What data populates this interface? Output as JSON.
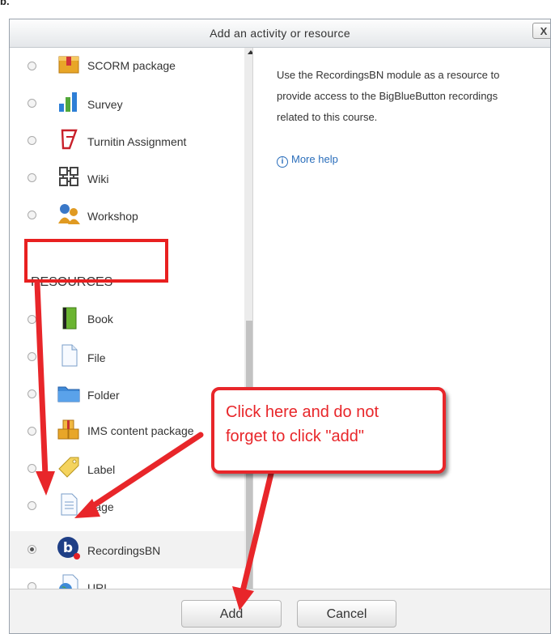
{
  "corner_text": "b.",
  "dialog": {
    "title": "Add an activity or resource",
    "close_label": "X"
  },
  "activities": [
    {
      "label": "SCORM package",
      "icon": "scorm-package-icon"
    },
    {
      "label": "Survey",
      "icon": "survey-chart-icon"
    },
    {
      "label": "Turnitin Assignment",
      "icon": "turnitin-icon"
    },
    {
      "label": "Wiki",
      "icon": "wiki-icon"
    },
    {
      "label": "Workshop",
      "icon": "workshop-people-icon"
    }
  ],
  "resources_heading": "RESOURCES",
  "resources": [
    {
      "label": "Book",
      "icon": "book-icon"
    },
    {
      "label": "File",
      "icon": "file-icon"
    },
    {
      "label": "Folder",
      "icon": "folder-icon"
    },
    {
      "label": "IMS content package",
      "icon": "ims-package-icon"
    },
    {
      "label": "Label",
      "icon": "label-tag-icon"
    },
    {
      "label": "Page",
      "icon": "page-icon"
    },
    {
      "label": "RecordingsBN",
      "icon": "bigbluebutton-icon",
      "selected": true
    },
    {
      "label": "URL",
      "icon": "url-globe-icon"
    }
  ],
  "description": {
    "line1": "Use the RecordingsBN module as a resource to",
    "line2": "provide access to the BigBlueButton recordings",
    "line3": "related to this course.",
    "more_help": "More help"
  },
  "buttons": {
    "add": "Add",
    "cancel": "Cancel"
  },
  "annotation": {
    "line1": "Click here and do not",
    "line2": "forget to click \"add\"",
    "color": "#e8262a"
  }
}
